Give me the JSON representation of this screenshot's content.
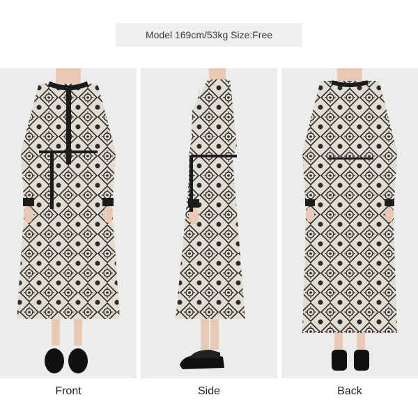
{
  "model_info": "Model 169cm/53kg Size:Free",
  "views": [
    {
      "label": "Front"
    },
    {
      "label": "Side"
    },
    {
      "label": "Back"
    }
  ],
  "colors": {
    "background": "#ececea",
    "fabric_light": "#e2ddd2",
    "fabric_dark": "#2a2a2a",
    "trim": "#1c1c1c",
    "skin": "#e9c9b5",
    "shoe": "#111111"
  }
}
